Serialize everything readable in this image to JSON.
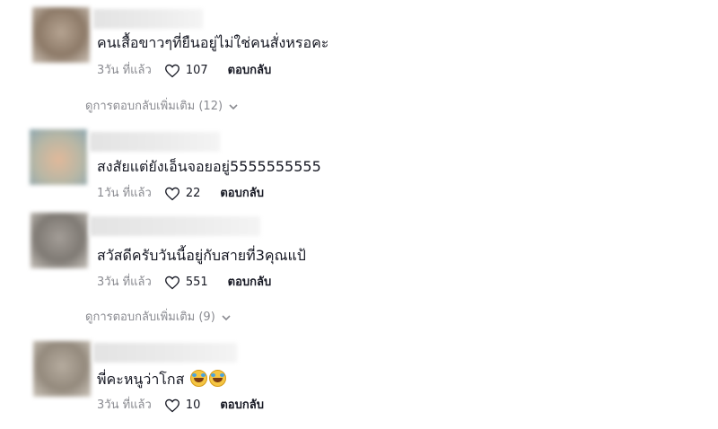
{
  "comments": [
    {
      "text": "คนเสื้อขาวๆที่ยืนอยู่ไม่ใช่คนสั่งหรอคะ",
      "time": "3วัน ที่แล้ว",
      "likes": "107",
      "reply_label": "ตอบกลับ",
      "view_more": "ดูการตอบกลับเพิ่มเติม (12)",
      "avatar_color": "#9c8a78"
    },
    {
      "text": "สงสัยแต่ยังเอ็นจอยอยู่5555555555",
      "time": "1วัน ที่แล้ว",
      "likes": "22",
      "reply_label": "ตอบกลับ",
      "avatar_color": "#b7b7a6"
    },
    {
      "text": "สวัสดีครับวันนี้อยู่กับสายที่3คุณแป้",
      "time": "3วัน ที่แล้ว",
      "likes": "551",
      "reply_label": "ตอบกลับ",
      "view_more": "ดูการตอบกลับเพิ่มเติม (9)",
      "avatar_color": "#8f8b86"
    },
    {
      "text": "พี่คะหนูว่าโกส",
      "time": "3วัน ที่แล้ว",
      "likes": "10",
      "reply_label": "ตอบกลับ",
      "avatar_color": "#a49a8c"
    }
  ],
  "icons": {
    "like": "heart-outline-icon",
    "expand": "chevron-down-icon",
    "emoji": "joy-emoji-icon"
  }
}
